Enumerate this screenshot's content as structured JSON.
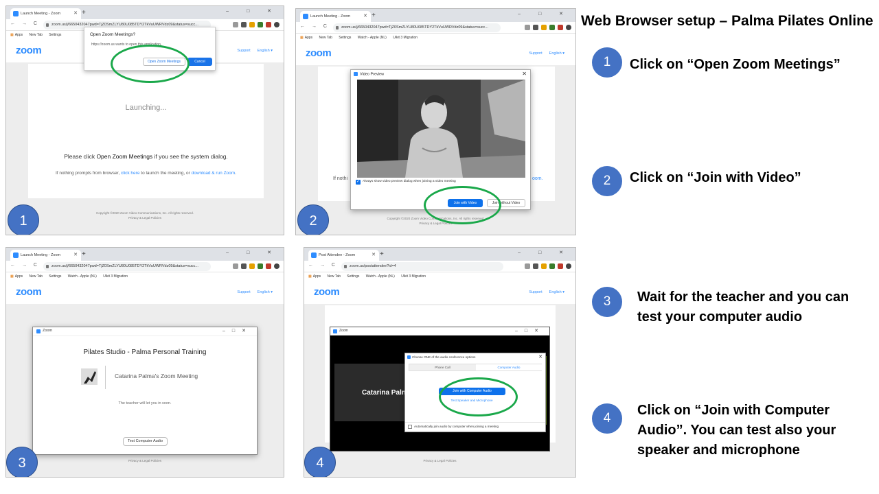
{
  "browser": {
    "tab_title_launch": "Launch Meeting - Zoom",
    "tab_title_post": "Post Attendee - Zoom",
    "url_launch": "zoom.us/j/6650432047pwd=TjZ0SmZLYU80U085TDY2TkVuUWRVdz09&status=succ...",
    "url_post": "zoom.us/postattendee?id=4",
    "new_tab_symbol": "+",
    "window_controls": "– □ ✕",
    "nav_icons": "← → C ⌂",
    "bookmarks": [
      "Apps",
      "New Tab",
      "Settings",
      "Watch - Apple (NL)",
      "Uikit 3 Migration"
    ]
  },
  "zoom_page": {
    "logo": "zoom",
    "support": "Support",
    "language": "English ▾",
    "footer_copyright": "Copyright ©2020 Zoom Video Communications, Inc. All rights reserved.",
    "footer_privacy": "Privacy & Legal Policies"
  },
  "shot1": {
    "dialog_title": "Open Zoom Meetings?",
    "dialog_text": "https://zoom.us wants to open this application.",
    "open_button": "Open Zoom Meetings",
    "cancel_button": "Cancel",
    "launching": "Launching...",
    "instruction_pre": "Please click ",
    "instruction_bold": "Open Zoom Meetings",
    "instruction_post": " if you see the system dialog.",
    "prompt_pre": "If nothing prompts from browser, ",
    "click_here": "click here",
    "prompt_mid": " to launch the meeting, or ",
    "download_link": "download & run Zoom",
    "prompt_end": ".",
    "badge": "1"
  },
  "shot2": {
    "dialog_title": "Video Preview",
    "checkbox_label": "Always show video preview dialog when joining a video meeting",
    "join_video_button": "Join with Video",
    "join_without_button": "Join without Video",
    "behind_text": "If nothi",
    "behind_link": "oom.",
    "badge": "2"
  },
  "shot3": {
    "window_title": "Zoom",
    "studio_name": "Pilates Studio - Palma Personal Training",
    "meeting_name": "Catarina Palma's Zoom Meeting",
    "wait_text": "The teacher will let you in soon.",
    "test_audio_button": "Test Computer Audio",
    "badge": "3"
  },
  "shot4": {
    "window_title": "Zoom",
    "dialog_title": "Choose ONE of the audio conference options",
    "tab_phone": "Phone Call",
    "tab_computer": "Computer Audio",
    "join_audio_button": "Join with Computer Audio",
    "test_link": "Test Speaker and Microphone",
    "auto_join_label": "Automatically join audio by computer when joining a meeting",
    "participant_name": "Catarina Palm",
    "badge": "4"
  },
  "instructions": {
    "title": "Web Browser setup – Palma Pilates Online",
    "steps": [
      {
        "number": "1",
        "text": "Click on “Open Zoom Meetings”"
      },
      {
        "number": "2",
        "text": "Click on “Join with Video”"
      },
      {
        "number": "3",
        "text": "Wait for the teacher and you can test your computer audio"
      },
      {
        "number": "4",
        "text": "Click on “Join with Computer Audio”. You can test also your speaker and microphone"
      }
    ]
  },
  "colors": {
    "badge_blue": "#4472c4",
    "highlight_green": "#1aa84a",
    "zoom_blue": "#2d8cff",
    "button_blue": "#0e71eb"
  }
}
